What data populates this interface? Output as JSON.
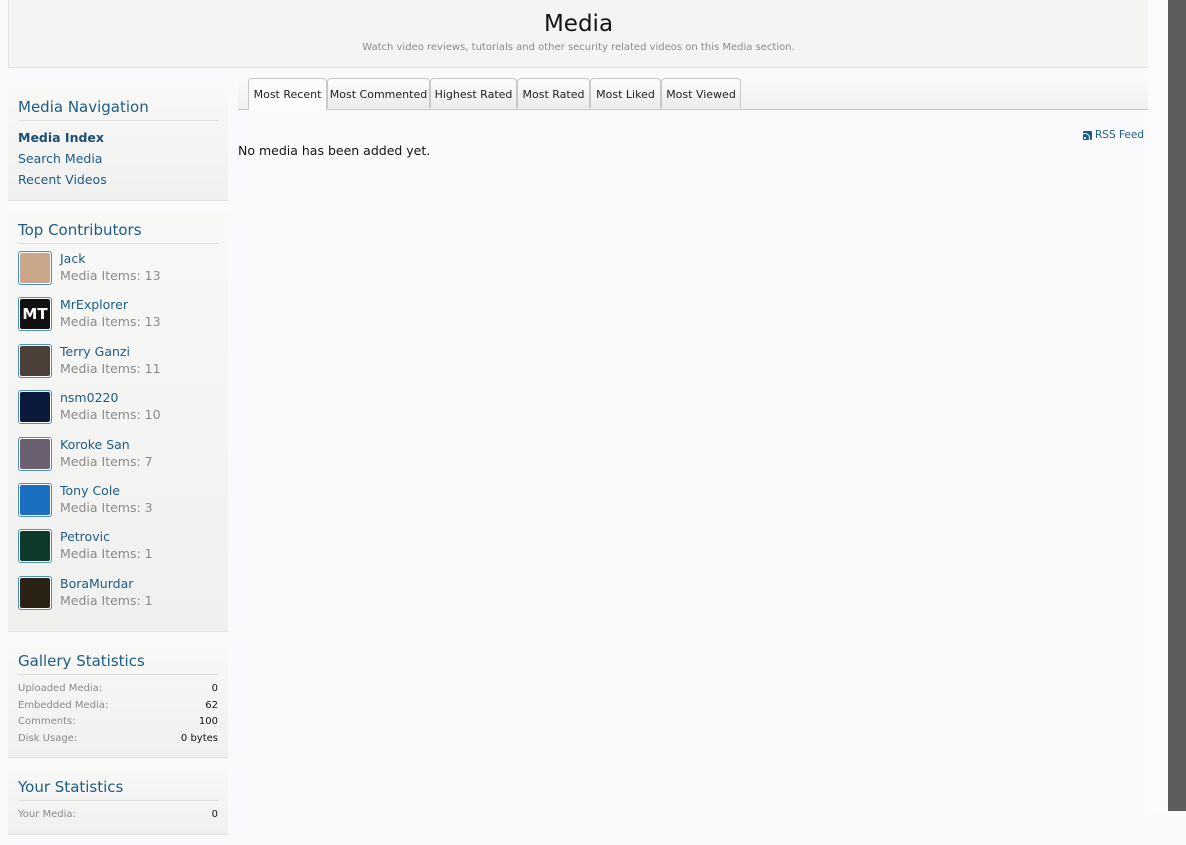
{
  "header": {
    "title": "Media",
    "subtitle": "Watch video reviews, tutorials and other security related videos on this Media section."
  },
  "tabs": [
    {
      "label": "Most Recent"
    },
    {
      "label": "Most Commented"
    },
    {
      "label": "Highest Rated"
    },
    {
      "label": "Most Rated"
    },
    {
      "label": "Most Liked"
    },
    {
      "label": "Most Viewed"
    }
  ],
  "main": {
    "rss_label": "RSS Feed",
    "empty_message": "No media has been added yet."
  },
  "media_navigation": {
    "title": "Media Navigation",
    "links": [
      {
        "label": "Media Index"
      },
      {
        "label": "Search Media"
      },
      {
        "label": "Recent Videos"
      }
    ]
  },
  "top_contributors": {
    "title": "Top Contributors",
    "items": [
      {
        "name": "Jack",
        "count": "Media Items: 13",
        "avatar_color": "#c9a58a"
      },
      {
        "name": "MrExplorer",
        "count": "Media Items: 13",
        "avatar_text": "MT",
        "avatar_color": "#111111"
      },
      {
        "name": "Terry Ganzi",
        "count": "Media Items: 11",
        "avatar_color": "#4a4038"
      },
      {
        "name": "nsm0220",
        "count": "Media Items: 10",
        "avatar_color": "#0b1a3a"
      },
      {
        "name": "Koroke San",
        "count": "Media Items: 7",
        "avatar_color": "#6b6070"
      },
      {
        "name": "Tony Cole",
        "count": "Media Items: 3",
        "avatar_color": "#1a6fc0"
      },
      {
        "name": "Petrovic",
        "count": "Media Items: 1",
        "avatar_color": "#0d3a2a"
      },
      {
        "name": "BoraMurdar",
        "count": "Media Items: 1",
        "avatar_color": "#2a2214"
      }
    ]
  },
  "gallery_statistics": {
    "title": "Gallery Statistics",
    "rows": [
      {
        "label": "Uploaded Media:",
        "value": "0"
      },
      {
        "label": "Embedded Media:",
        "value": "62"
      },
      {
        "label": "Comments:",
        "value": "100"
      },
      {
        "label": "Disk Usage:",
        "value": "0 bytes"
      }
    ]
  },
  "your_statistics": {
    "title": "Your Statistics",
    "rows": [
      {
        "label": "Your Media:",
        "value": "0"
      }
    ]
  }
}
